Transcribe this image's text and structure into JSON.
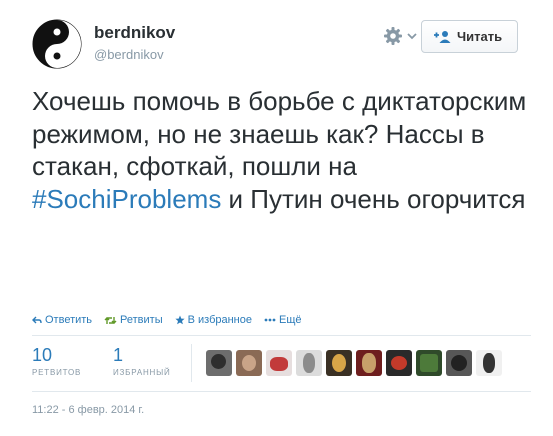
{
  "author": {
    "display_name": "berdnikov",
    "screen_name": "@berdnikov",
    "avatar_icon": "yin-yang-icon"
  },
  "header": {
    "settings_icon": "gear-icon",
    "follow_label": "Читать",
    "follow_icon": "add-user-icon"
  },
  "tweet": {
    "text_before": "Хочешь помочь в борьбе с диктаторским режимом, но не знаешь как? Нассы в стакан, сфоткай, пошли на ",
    "hashtag": "#SochiProblems",
    "text_after": " и Путин очень огорчится"
  },
  "actions": [
    {
      "label": "Ответить",
      "icon": "reply-icon"
    },
    {
      "label": "Ретвиты",
      "icon": "retweet-icon"
    },
    {
      "label": "В избранное",
      "icon": "star-icon"
    },
    {
      "label": "Ещё",
      "icon": "more-icon"
    }
  ],
  "stats": {
    "retweets": {
      "value": "10",
      "label": "РЕТВИТОВ"
    },
    "favorites": {
      "value": "1",
      "label": "ИЗБРАННЫЙ"
    }
  },
  "timestamp": "11:22 - 6 февр. 2014 г.",
  "colors": {
    "link": "#2b7bb9",
    "muted": "#8899a6",
    "text": "#292f33",
    "border": "#e1e8ed"
  }
}
